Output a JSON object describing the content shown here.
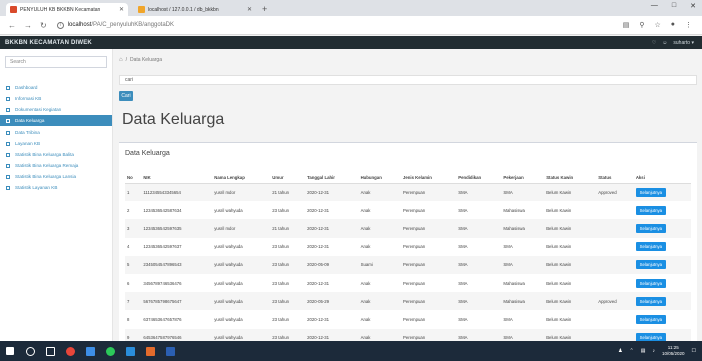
{
  "browser": {
    "tabs": [
      {
        "title": "PENYULUH KB BKKBN Kecamatan",
        "active": true,
        "favicon_color": "#d94a2b"
      },
      {
        "title": "localhost / 127.0.0.1 / db_bkkbn",
        "active": false,
        "favicon_color": "#f0a52a"
      }
    ],
    "url_host": "localhost",
    "url_path": "/PA/C_penyuluhKB/anggotaDK"
  },
  "header": {
    "brand": "BKKBN KECAMATAN DIWEK",
    "user": "suharto"
  },
  "sidebar": {
    "search_placeholder": "Search",
    "items": [
      {
        "label": "Dashboard",
        "active": false
      },
      {
        "label": "Informasi KB",
        "active": false
      },
      {
        "label": "Dokumentasi Kegiatan",
        "active": false
      },
      {
        "label": "Data Keluarga",
        "active": true
      },
      {
        "label": "Data Tribina",
        "active": false
      },
      {
        "label": "Layanan KB",
        "active": false
      },
      {
        "label": "Statistik Bina Keluarga Balita",
        "active": false
      },
      {
        "label": "Statistik Bina Keluarga Remaja",
        "active": false
      },
      {
        "label": "Statistik Bina Keluarga Lansia",
        "active": false
      },
      {
        "label": "Statistik Layanan KB",
        "active": false
      }
    ]
  },
  "breadcrumb": {
    "current": "Data Keluarga"
  },
  "search": {
    "value": "cari"
  },
  "cari_button": "Cari",
  "page_title": "Data Keluarga",
  "box_title": "Data Keluarga",
  "table": {
    "headers": [
      "No",
      "NIK",
      "Nama Lengkap",
      "Umur",
      "Tanggal Lahir",
      "Hubungan",
      "Jenis Kelamin",
      "Pendidikan",
      "Pekerjaan",
      "Status Kawin",
      "Status",
      "Aksi"
    ],
    "rows": [
      [
        "1",
        "1112345543345654",
        "yusril mdor",
        "21 tahun",
        "2020-12-31",
        "Anak",
        "Perempuan",
        "SMA",
        "SMA",
        "Belum Kawin",
        "Approved",
        "Selanjutnya"
      ],
      [
        "2",
        "1234536542587634",
        "yusril wahyuda",
        "23 tahun",
        "2020-12-31",
        "Anak",
        "Perempuan",
        "SMA",
        "Mahasiswa",
        "Belum Kawin",
        "",
        "Selanjutnya"
      ],
      [
        "3",
        "1234536542597635",
        "yusril mdor",
        "21 tahun",
        "2020-12-31",
        "Anak",
        "Perempuan",
        "SMA",
        "Mahasiswa",
        "Belum Kawin",
        "",
        "Selanjutnya"
      ],
      [
        "4",
        "1234536542597637",
        "yusril wahyuda",
        "23 tahun",
        "2020-12-31",
        "Anak",
        "Perempuan",
        "SMA",
        "SMA",
        "Belum Kawin",
        "",
        "Selanjutnya"
      ],
      [
        "5",
        "2345054547896543",
        "yusril wahyuda",
        "23 tahun",
        "2020-05-09",
        "Suami",
        "Perempuan",
        "SMA",
        "SMA",
        "Belum Kawin",
        "",
        "Selanjutnya"
      ],
      [
        "6",
        "3456789746536476",
        "yusril wahyuda",
        "23 tahun",
        "2020-12-31",
        "Anak",
        "Perempuan",
        "SMA",
        "Mahasiswa",
        "Belum Kawin",
        "",
        "Selanjutnya"
      ],
      [
        "7",
        "5676785798675647",
        "yusril wahyuda",
        "23 tahun",
        "2020-05-29",
        "Anak",
        "Perempuan",
        "SMA",
        "Mahasiswa",
        "Belum Kawin",
        "Approved",
        "Selanjutnya"
      ],
      [
        "8",
        "6374653647657876",
        "yusril wahyuda",
        "23 tahun",
        "2020-12-31",
        "Anak",
        "Perempuan",
        "SMA",
        "SMA",
        "Belum Kawin",
        "",
        "Selanjutnya"
      ],
      [
        "9",
        "6453647587976546",
        "yusril wahyuda",
        "23 tahun",
        "2020-12-31",
        "Anak",
        "Perempuan",
        "SMA",
        "SMA",
        "Belum Kawin",
        "",
        "Selanjutnya"
      ]
    ]
  },
  "taskbar": {
    "time": "11:25",
    "date": "10/05/2020",
    "app_icons": [
      {
        "name": "start-icon",
        "color": "#ffffff"
      },
      {
        "name": "search-icon",
        "color": "#ffffff"
      },
      {
        "name": "task-view-icon",
        "color": "#ffffff"
      },
      {
        "name": "chrome-icon",
        "color": "#e8463a"
      },
      {
        "name": "explorer-icon",
        "color": "#3d8ee6"
      },
      {
        "name": "whatsapp-icon",
        "color": "#2cc85a"
      },
      {
        "name": "vscode-icon",
        "color": "#2a8ddb"
      },
      {
        "name": "xampp-icon",
        "color": "#e36b2c"
      },
      {
        "name": "word-icon",
        "color": "#2b5fb2"
      }
    ]
  }
}
